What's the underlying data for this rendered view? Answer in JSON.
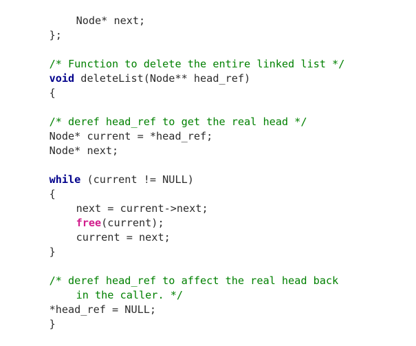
{
  "code": {
    "line1": {
      "text": "Node* next;"
    },
    "line2": {
      "text": "};"
    },
    "line4": {
      "text": "/* Function to delete the entire linked list */"
    },
    "line5": {
      "keyword": "void",
      "rest": " deleteList(Node** head_ref)"
    },
    "line6": {
      "text": "{"
    },
    "line8": {
      "text": "/* deref head_ref to get the real head */"
    },
    "line9": {
      "text": "Node* current = *head_ref;"
    },
    "line10": {
      "text": "Node* next;"
    },
    "line12": {
      "keyword": "while",
      "rest": " (current != NULL)"
    },
    "line13": {
      "text": "{"
    },
    "line14": {
      "text": "next = current->next;"
    },
    "line15": {
      "builtin": "free",
      "rest": "(current);"
    },
    "line16": {
      "text": "current = next;"
    },
    "line17": {
      "text": "}"
    },
    "line19": {
      "text": "/* deref head_ref to affect the real head back"
    },
    "line20": {
      "text": "in the caller. */"
    },
    "line21": {
      "text": "*head_ref = NULL;"
    },
    "line22": {
      "text": "}"
    }
  },
  "colors": {
    "background": "#ffffff",
    "text": "#2b2b2b",
    "comment": "#008000",
    "keyword": "#00008b",
    "builtin": "#d11d8c"
  }
}
